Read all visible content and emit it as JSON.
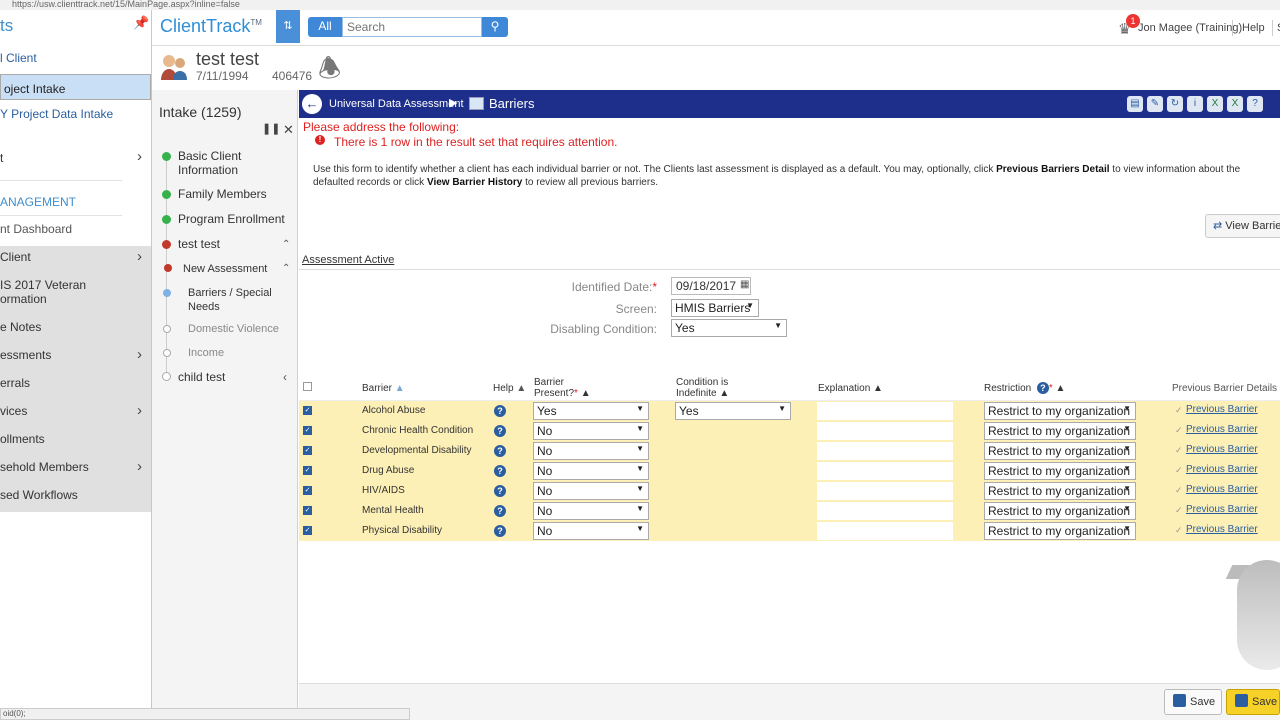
{
  "url": "https://usw.clienttrack.net/15/MainPage.aspx?inline=false",
  "left_nav": {
    "title_fragment": "ts",
    "items": [
      {
        "label": "l Client"
      },
      {
        "label": "oject Intake"
      },
      {
        "label": "Y Project Data Intake"
      },
      {
        "label": "t"
      },
      {
        "label": "ANAGEMENT"
      },
      {
        "label": "nt Dashboard"
      },
      {
        "label": " Client"
      },
      {
        "label": "IS 2017 Veteran"
      },
      {
        "label": "ormation"
      },
      {
        "label": "e Notes"
      },
      {
        "label": "essments"
      },
      {
        "label": "errals"
      },
      {
        "label": "vices"
      },
      {
        "label": "ollments"
      },
      {
        "label": "sehold Members"
      },
      {
        "label": "sed Workflows"
      }
    ]
  },
  "topbar": {
    "logo": "ClientTrack",
    "logo_tm": "TM",
    "all_label": "All",
    "search_placeholder": "Search",
    "notification_count": "1",
    "user": "Jon Magee (Training)",
    "help": "Help",
    "extra": "S"
  },
  "client": {
    "name": "test test",
    "dob": "7/11/1994",
    "id": "406476"
  },
  "workflow": {
    "title": "Intake (1259)",
    "items": [
      {
        "label": "Basic Client Information"
      },
      {
        "label": "Family Members"
      },
      {
        "label": "Program Enrollment"
      },
      {
        "label": "test test"
      },
      {
        "label": "New Assessment"
      },
      {
        "label": "Barriers / Special Needs"
      },
      {
        "label": "Domestic Violence"
      },
      {
        "label": "Income"
      },
      {
        "label": "child test"
      }
    ]
  },
  "ribbon": {
    "breadcrumb": "Universal Data Assessment",
    "form_title": "Barriers"
  },
  "errors": {
    "title": "Please address the following:",
    "message": "There is 1 row in the result set that requires attention."
  },
  "info": {
    "part1": "Use this form to identify whether a client has each individual barrier or not.  The Clients last assessment is displayed as a default. You may, optionally, click ",
    "bold1": "Previous Barriers Detail",
    "part2": " to view information about the defaulted records or click ",
    "bold2": "View Barrier History",
    "part3": " to review all previous barriers."
  },
  "view_barrier_button": "View Barrier",
  "assessment_tab": "Assessment Active",
  "fields": {
    "identified_date_label": "Identified Date:",
    "identified_date": "09/18/2017",
    "screen_label": "Screen:",
    "screen_value": "HMIS Barriers",
    "disabling_label": "Disabling Condition:",
    "disabling_value": "Yes"
  },
  "table": {
    "headers": {
      "barrier": "Barrier",
      "help": "Help",
      "present_1": "Barrier",
      "present_2": "Present?",
      "indef_1": "Condition is",
      "indef_2": "Indefinite",
      "explanation": "Explanation",
      "restriction": "Restriction",
      "previous": "Previous Barrier Details"
    },
    "rows": [
      {
        "barrier": "Alcohol Abuse",
        "present": "Yes",
        "indefinite": "Yes",
        "restriction": "Restrict to my organization",
        "previous": "Previous Barrier"
      },
      {
        "barrier": "Chronic Health Condition",
        "present": "No",
        "indefinite": "",
        "restriction": "Restrict to my organization",
        "previous": "Previous Barrier"
      },
      {
        "barrier": "Developmental Disability",
        "present": "No",
        "indefinite": "",
        "restriction": "Restrict to my organization",
        "previous": "Previous Barrier"
      },
      {
        "barrier": "Drug Abuse",
        "present": "No",
        "indefinite": "",
        "restriction": "Restrict to my organization",
        "previous": "Previous Barrier"
      },
      {
        "barrier": "HIV/AIDS",
        "present": "No",
        "indefinite": "",
        "restriction": "Restrict to my organization",
        "previous": "Previous Barrier"
      },
      {
        "barrier": "Mental Health",
        "present": "No",
        "indefinite": "",
        "restriction": "Restrict to my organization",
        "previous": "Previous Barrier"
      },
      {
        "barrier": "Physical Disability",
        "present": "No",
        "indefinite": "",
        "restriction": "Restrict to my organization",
        "previous": "Previous Barrier"
      }
    ]
  },
  "footer": {
    "save": "Save",
    "save_close": "Save"
  },
  "status_bar": "oid(0);",
  "icons": {
    "accent": "#1d2f8a",
    "brand": "#2f8ed6",
    "row_highlight": "#fdf0b6",
    "error": "#dd2222"
  }
}
